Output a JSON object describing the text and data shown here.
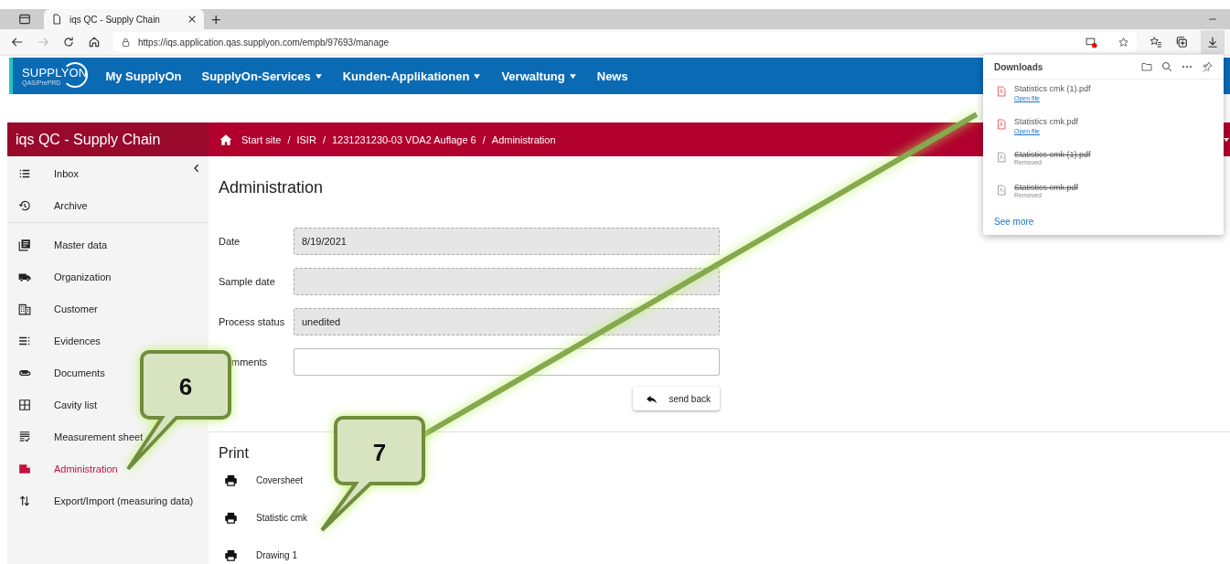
{
  "browser": {
    "tabs": [
      {
        "title": "iqs QC - Supply Chain",
        "selected": true
      }
    ],
    "new_tab": "+",
    "url": "https://iqs.application.qas.supplyon.com/empb/97693/manage"
  },
  "portal_nav": {
    "logo": "SUPPLYON",
    "logo_sub": "QAS/PrePRD",
    "items": [
      {
        "label": "My SupplyOn",
        "menu": false
      },
      {
        "label": "SupplyOn-Services",
        "menu": true
      },
      {
        "label": "Kunden-Applikationen",
        "menu": true
      },
      {
        "label": "Verwaltung",
        "menu": true
      },
      {
        "label": "News",
        "menu": false
      }
    ]
  },
  "app": {
    "title": "iqs QC - Supply Chain",
    "breadcrumb": [
      "Start site",
      "ISIR",
      "1231231230-03 VDA2 Auflage 6",
      "Administration"
    ],
    "breadcrumb_separators": [
      "/",
      "/",
      "/"
    ]
  },
  "sidebar": {
    "groups": [
      [
        {
          "label": "Inbox",
          "selected": false
        },
        {
          "label": "Archive",
          "selected": false
        }
      ],
      [
        {
          "label": "Master data",
          "selected": false
        },
        {
          "label": "Organization",
          "selected": false
        },
        {
          "label": "Customer",
          "selected": false
        },
        {
          "label": "Evidences",
          "selected": false
        },
        {
          "label": "Documents",
          "selected": false
        },
        {
          "label": "Cavity list",
          "selected": false
        },
        {
          "label": "Measurement sheet",
          "selected": false
        },
        {
          "label": "Administration",
          "selected": true
        },
        {
          "label": "Export/Import (measuring data)",
          "selected": false
        }
      ]
    ]
  },
  "administration": {
    "title": "Administration",
    "fields": [
      {
        "label": "Date",
        "value": "8/19/2021",
        "kind": "readonly"
      },
      {
        "label": "Sample date",
        "kind": "readonly"
      },
      {
        "label": "Process status",
        "value": "unedited",
        "kind": "readonly"
      },
      {
        "label": "mments",
        "kind": "input"
      }
    ],
    "button": "send back"
  },
  "print": {
    "title": "Print",
    "items": [
      "Coversheet",
      "Statistic cmk",
      "Drawing 1"
    ]
  },
  "downloads": {
    "title": "Downloads",
    "items": [
      {
        "name": "Statistics cmk (1).pdf",
        "status": "Open file",
        "removed": false
      },
      {
        "name": "Statistics cmk.pdf",
        "status": "Open file",
        "removed": false
      },
      {
        "name": "Statistics cmk (1).pdf",
        "status": "Removed",
        "removed": true
      },
      {
        "name": "Statistics cmk.pdf",
        "status": "Removed",
        "removed": true
      }
    ],
    "see_more": "See more"
  },
  "callouts": [
    {
      "number": "6"
    },
    {
      "number": "7"
    }
  ]
}
